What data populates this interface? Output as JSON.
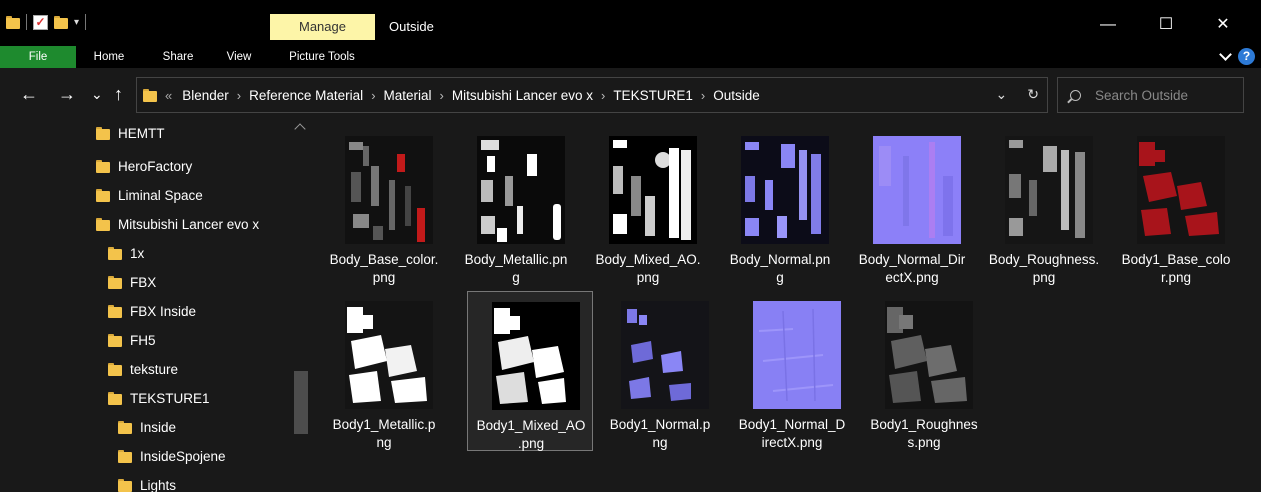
{
  "titlebar": {
    "manage_label": "Manage",
    "window_title": "Outside",
    "minimize": "—",
    "maximize": "☐",
    "close": "✕"
  },
  "ribbon": {
    "tabs": [
      "File",
      "Home",
      "Share",
      "View",
      "Picture Tools"
    ],
    "help": "?"
  },
  "nav": {
    "back": "←",
    "forward": "→",
    "recent": "⌄",
    "up": "↑"
  },
  "address": {
    "overflow": "«",
    "crumbs": [
      "Blender",
      "Reference Material",
      "Material",
      "Mitsubishi Lancer evo x",
      "TEKSTURE1",
      "Outside"
    ],
    "dropdown": "⌄",
    "refresh": "↻"
  },
  "search": {
    "placeholder": "Search Outside"
  },
  "sidebar": {
    "items": [
      {
        "label": "HEMTT",
        "level": 0
      },
      {
        "label": "HeroFactory",
        "level": 0
      },
      {
        "label": "Liminal Space",
        "level": 0
      },
      {
        "label": "Mitsubishi Lancer evo x",
        "level": 0
      },
      {
        "label": "1x",
        "level": 1
      },
      {
        "label": "FBX",
        "level": 1
      },
      {
        "label": "FBX Inside",
        "level": 1
      },
      {
        "label": "FH5",
        "level": 1
      },
      {
        "label": "teksture",
        "level": 1
      },
      {
        "label": "TEKSTURE1",
        "level": 1
      },
      {
        "label": "Inside",
        "level": 2
      },
      {
        "label": "InsideSpojene",
        "level": 2
      },
      {
        "label": "Lights",
        "level": 2
      }
    ]
  },
  "files": [
    {
      "line1": "Body_Base_color.",
      "line2": "png",
      "kind": "base"
    },
    {
      "line1": "Body_Metallic.pn",
      "line2": "g",
      "kind": "metal"
    },
    {
      "line1": "Body_Mixed_AO.",
      "line2": "png",
      "kind": "ao"
    },
    {
      "line1": "Body_Normal.pn",
      "line2": "g",
      "kind": "normal"
    },
    {
      "line1": "Body_Normal_Dir",
      "line2": "ectX.png",
      "kind": "normaldx"
    },
    {
      "line1": "Body_Roughness.",
      "line2": "png",
      "kind": "rough"
    },
    {
      "line1": "Body1_Base_colo",
      "line2": "r.png",
      "kind": "base1"
    },
    {
      "line1": "Body1_Metallic.p",
      "line2": "ng",
      "kind": "metal1"
    },
    {
      "line1": "Body1_Mixed_AO",
      "line2": ".png",
      "kind": "ao1",
      "selected": true
    },
    {
      "line1": "Body1_Normal.p",
      "line2": "ng",
      "kind": "normal1"
    },
    {
      "line1": "Body1_Normal_D",
      "line2": "irectX.png",
      "kind": "normaldx1"
    },
    {
      "line1": "Body1_Roughnes",
      "line2": "s.png",
      "kind": "rough1"
    }
  ]
}
